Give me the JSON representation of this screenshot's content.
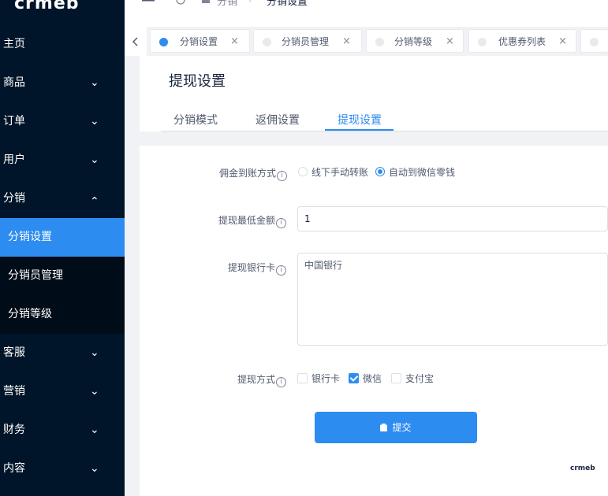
{
  "logo": "crmeb",
  "sidebar": {
    "items": [
      {
        "label": "主页",
        "chevron": ""
      },
      {
        "label": "商品",
        "chevron": "⌄"
      },
      {
        "label": "订单",
        "chevron": "⌄"
      },
      {
        "label": "用户",
        "chevron": "⌄"
      },
      {
        "label": "分销",
        "chevron": "⌃"
      },
      {
        "label": "客服",
        "chevron": "⌄"
      },
      {
        "label": "营销",
        "chevron": "⌄"
      },
      {
        "label": "财务",
        "chevron": "⌄"
      },
      {
        "label": "内容",
        "chevron": "⌄"
      }
    ],
    "submenu": [
      {
        "label": "分销设置"
      },
      {
        "label": "分销员管理"
      },
      {
        "label": "分销等级"
      }
    ]
  },
  "header": {
    "breadcrumb": [
      "分销",
      "/",
      "分销设置"
    ]
  },
  "tags": [
    {
      "label": "分销设置",
      "close": "×"
    },
    {
      "label": "分销员管理",
      "close": "×"
    },
    {
      "label": "分销等级",
      "close": "×"
    },
    {
      "label": "优惠券列表",
      "close": "×"
    }
  ],
  "page": {
    "title": "提现设置",
    "tabs": [
      "分销模式",
      "返佣设置",
      "提现设置"
    ]
  },
  "form": {
    "account_method": {
      "label": "佣金到账方式",
      "options": [
        "线下手动转账",
        "自动到微信零钱"
      ]
    },
    "min_amount": {
      "label": "提现最低金额",
      "value": "1"
    },
    "bank_card": {
      "label": "提现银行卡",
      "value": "中国银行"
    },
    "withdraw_method": {
      "label": "提现方式",
      "options": [
        "银行卡",
        "微信",
        "支付宝"
      ]
    },
    "info_glyph": "i",
    "submit_label": "提交"
  },
  "watermark": "crmeb",
  "colors": {
    "primary": "#2d8cf0",
    "sidebar_bg": "#001529",
    "submenu_bg": "#000c17"
  }
}
